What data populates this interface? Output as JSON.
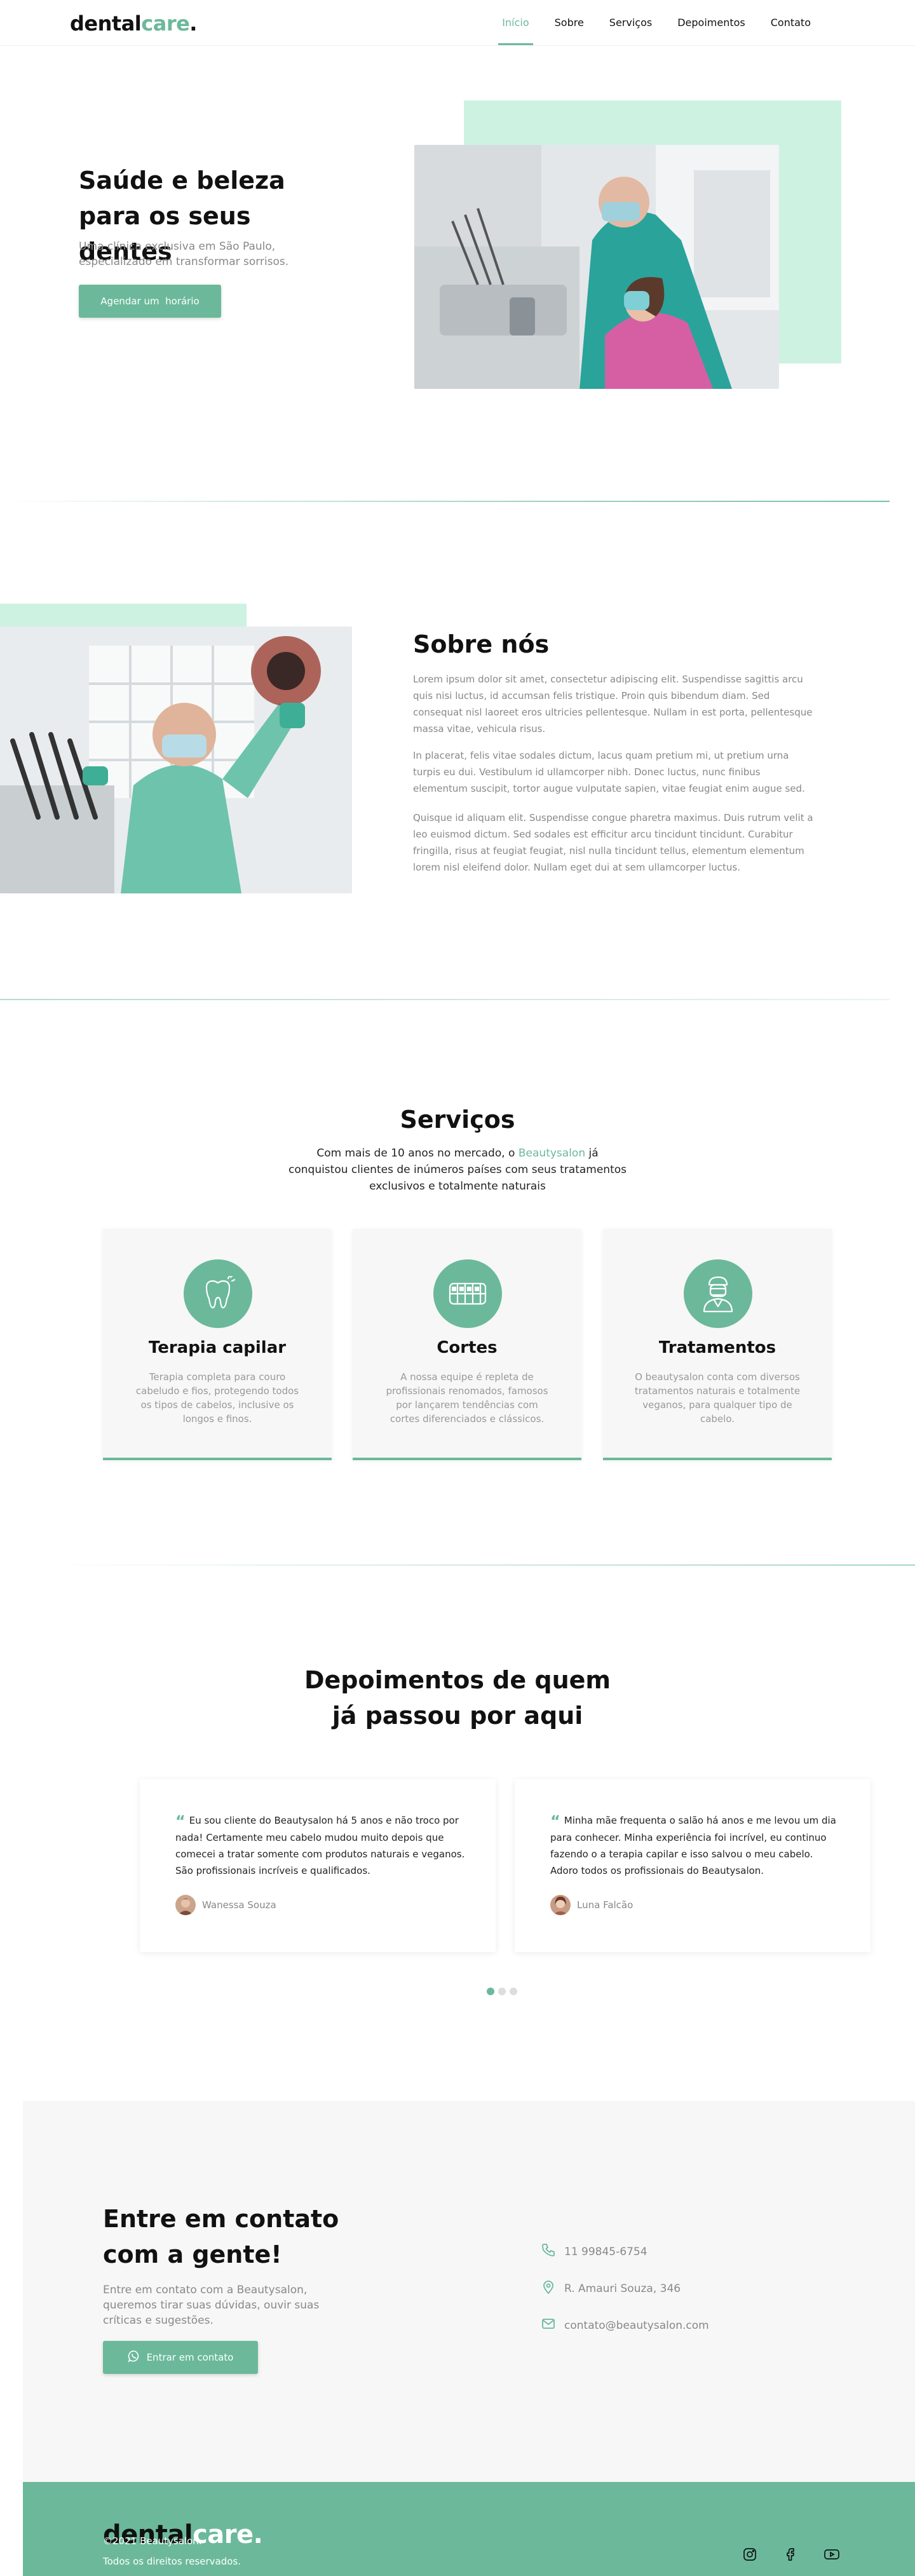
{
  "header": {
    "logo_main": "dental",
    "logo_accent": "care",
    "logo_dot": ".",
    "nav": [
      "Início",
      "Sobre",
      "Serviços",
      "Depoimentos",
      "Contato"
    ]
  },
  "hero": {
    "title": "Saúde e beleza para os seus dentes",
    "subtitle": "Uma clínica exclusiva em São Paulo, especializado em transformar sorrisos.",
    "button": "Agendar um  horário"
  },
  "about": {
    "title": "Sobre nós",
    "paragraphs": [
      "Lorem ipsum dolor sit amet, consectetur adipiscing elit. Suspendisse sagittis arcu quis nisi luctus, id accumsan felis tristique. Proin quis bibendum diam. Sed consequat nisl laoreet eros ultricies pellentesque. Nullam in est porta, pellentesque massa vitae, vehicula risus.",
      "In placerat, felis vitae sodales dictum, lacus quam pretium mi, ut pretium urna turpis eu dui. Vestibulum id ullamcorper nibh. Donec luctus, nunc finibus elementum suscipit, tortor augue vulputate sapien, vitae feugiat enim augue sed.",
      "Quisque id aliquam elit. Suspendisse congue pharetra maximus. Duis rutrum velit a leo euismod dictum. Sed sodales est efficitur arcu tincidunt tincidunt. Curabitur fringilla, risus at feugiat feugiat, nisl nulla tincidunt tellus, elementum elementum lorem nisl eleifend dolor. Nullam eget dui at sem ullamcorper luctus."
    ]
  },
  "services": {
    "title": "Serviços",
    "subtitle_before": "Com mais de 10 anos no mercado, o ",
    "subtitle_brand": "Beautysalon",
    "subtitle_after": " já conquistou clientes de inúmeros países com seus tratamentos exclusivos e totalmente naturais",
    "cards": [
      {
        "title": "Terapia capilar",
        "text": "Terapia completa para couro cabeludo e fios, protegendo todos os tipos de cabelos, inclusive os longos e finos.",
        "icon": "tooth-icon"
      },
      {
        "title": "Cortes",
        "text": "A nossa equipe é repleta de profissionais renomados, famosos por lançarem tendências com cortes diferenciados e clássicos.",
        "icon": "teeth-braces-icon"
      },
      {
        "title": "Tratamentos",
        "text": "O beautysalon conta com diversos tratamentos naturais e totalmente veganos, para qualquer tipo de cabelo.",
        "icon": "dentist-icon"
      }
    ]
  },
  "testimonials": {
    "title": "Depoimentos de quem já passou por aqui",
    "items": [
      {
        "quote": "Eu sou cliente do Beautysalon há 5 anos e não troco por nada! Certamente meu cabelo mudou muito depois que comecei a tratar somente com produtos naturais e veganos. São profissionais incríveis e qualificados.",
        "author": "Wanessa Souza"
      },
      {
        "quote": "Minha mãe frequenta o salão há anos e me levou um dia para conhecer. Minha experiência foi incrível, eu continuo fazendo o a terapia capilar e isso salvou o meu cabelo. Adoro todos os profissionais do Beautysalon.",
        "author": "Luna Falcão"
      }
    ],
    "active_dot": 1,
    "dot_count": 3
  },
  "contact": {
    "title": "Entre em contato com a gente!",
    "subtitle": "Entre em contato com a Beautysalon, queremos tirar suas dúvidas, ouvir suas críticas e sugestões.",
    "button": "Entrar em contato",
    "phone": "11 99845-6754",
    "address": "R. Amauri Souza, 346",
    "email": "contato@beautysalon.com"
  },
  "footer": {
    "logo_main": "dental",
    "logo_accent": "care",
    "logo_dot": ".",
    "copyright": "©2021 Beautysalon.",
    "rights": "Todos os direitos reservados.",
    "social": [
      "instagram-icon",
      "facebook-icon",
      "youtube-icon"
    ]
  },
  "colors": {
    "accent": "#6bb99a",
    "mint": "#cdf2e2",
    "light_bg": "#f7f7f7"
  }
}
